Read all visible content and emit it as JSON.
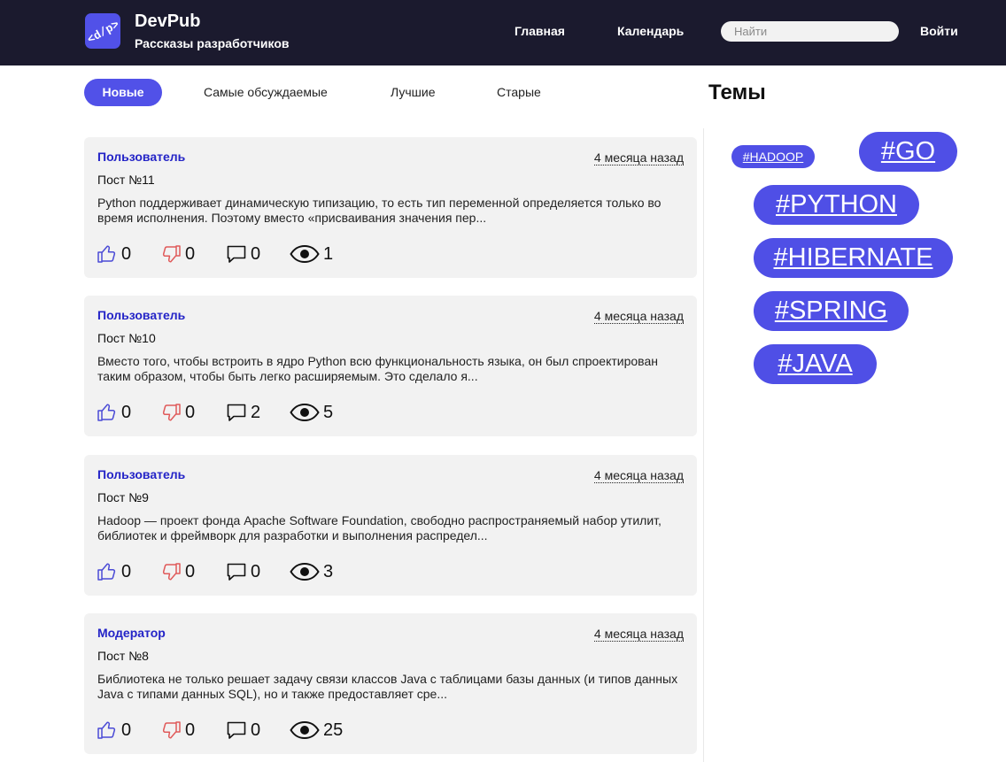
{
  "header": {
    "logo_icon": "code-tag-icon",
    "title": "DevPub",
    "subtitle": "Рассказы разработчиков",
    "nav": {
      "home": "Главная",
      "calendar": "Календарь"
    },
    "search_placeholder": "Найти",
    "login": "Войти"
  },
  "sort_tabs": [
    "Новые",
    "Самые обсуждаемые",
    "Лучшие",
    "Старые"
  ],
  "posts": [
    {
      "author": "Пользователь",
      "date": "4 месяца назад",
      "title": "Пост №11",
      "excerpt": "Python поддерживает динамическую типизацию, то есть тип переменной определяется только во время исполнения. Поэтому вместо «присваивания значения пер...",
      "likes": "0",
      "dislikes": "0",
      "comments": "0",
      "views": "1"
    },
    {
      "author": "Пользователь",
      "date": "4 месяца назад",
      "title": "Пост №10",
      "excerpt": "Вместо того, чтобы встроить в ядро Python всю функциональность языка, он был спроектирован таким образом, чтобы быть легко расширяемым. Это сделало я...",
      "likes": "0",
      "dislikes": "0",
      "comments": "2",
      "views": "5"
    },
    {
      "author": "Пользователь",
      "date": "4 месяца назад",
      "title": "Пост №9",
      "excerpt": "Hadoop — проект фонда Apache Software Foundation, свободно распространяемый набор утилит, библиотек и фреймворк для разработки и выполнения распредел...",
      "likes": "0",
      "dislikes": "0",
      "comments": "0",
      "views": "3"
    },
    {
      "author": "Модератор",
      "date": "4 месяца назад",
      "title": "Пост №8",
      "excerpt": "Библиотека не только решает задачу связи классов Java с таблицами базы данных (и типов данных Java с типами данных SQL), но и также предоставляет сре...",
      "likes": "0",
      "dislikes": "0",
      "comments": "0",
      "views": "25"
    }
  ],
  "themes": {
    "title": "Темы",
    "tags": [
      "#HADOOP",
      "#GO",
      "#PYTHON",
      "#HIBERNATE",
      "#SPRING",
      "#JAVA"
    ]
  },
  "colors": {
    "header_bg": "#1b1a2e",
    "accent": "#5151e8",
    "author_link": "#2424c7",
    "card_bg": "#f2f2f2",
    "like_icon": "#4b4bd6",
    "dislike_icon": "#e05a5a"
  }
}
